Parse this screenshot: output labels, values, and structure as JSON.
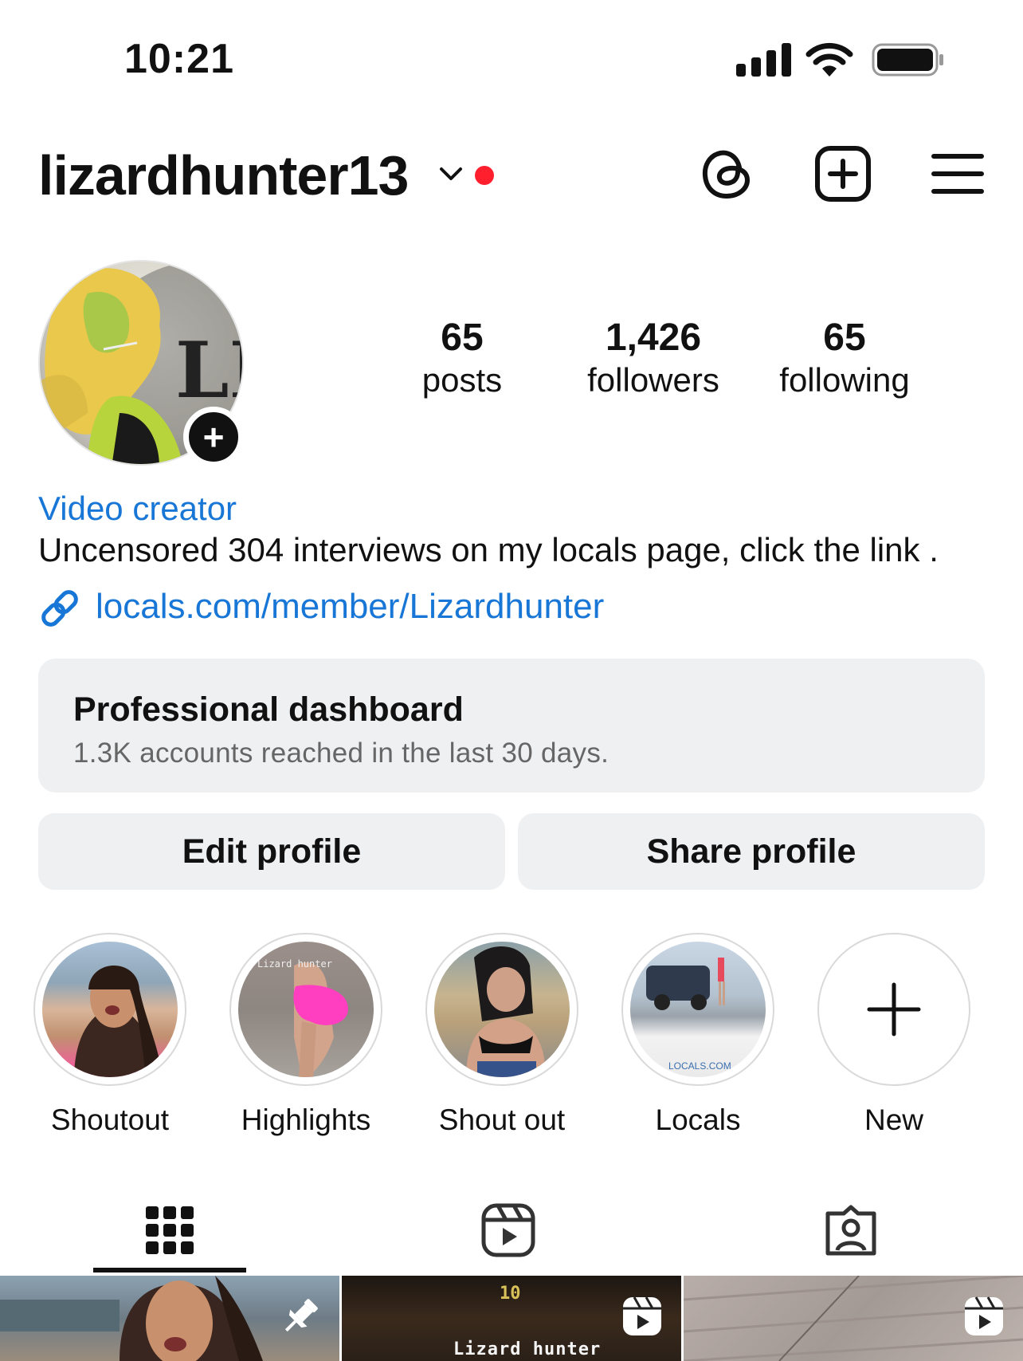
{
  "status_bar": {
    "time": "10:21"
  },
  "header": {
    "username": "lizardhunter13"
  },
  "avatar": {
    "logo_text": "LH"
  },
  "stats": [
    {
      "value": "65",
      "label": "posts"
    },
    {
      "value": "1,426",
      "label": "followers"
    },
    {
      "value": "65",
      "label": "following"
    }
  ],
  "bio": {
    "category": "Video creator",
    "text": "Uncensored 304 interviews on my locals page, click the link .",
    "link": "locals.com/member/Lizardhunter"
  },
  "dashboard": {
    "title": "Professional dashboard",
    "subtitle": "1.3K accounts reached in the last 30 days."
  },
  "buttons": {
    "edit": "Edit profile",
    "share": "Share profile"
  },
  "highlights": [
    {
      "label": "Shoutout"
    },
    {
      "label": "Highlights",
      "overlay": "Lizard hunter"
    },
    {
      "label": "Shout out"
    },
    {
      "label": "Locals",
      "overlay": "LOCALS.COM"
    },
    {
      "label": "New"
    }
  ],
  "grid": {
    "posts": [
      {
        "pinned": true
      },
      {
        "caption": "Lizard hunter",
        "overlay_num": "10",
        "reel": true
      },
      {
        "reel": true
      }
    ]
  },
  "colors": {
    "link": "#1877d6",
    "notification_dot": "#ff1f2d",
    "button_bg": "#eff0f2"
  },
  "icons": [
    "threads-icon",
    "add-post-icon",
    "menu-icon",
    "grid-icon",
    "reels-icon",
    "tagged-icon",
    "pin-icon",
    "link-icon"
  ]
}
